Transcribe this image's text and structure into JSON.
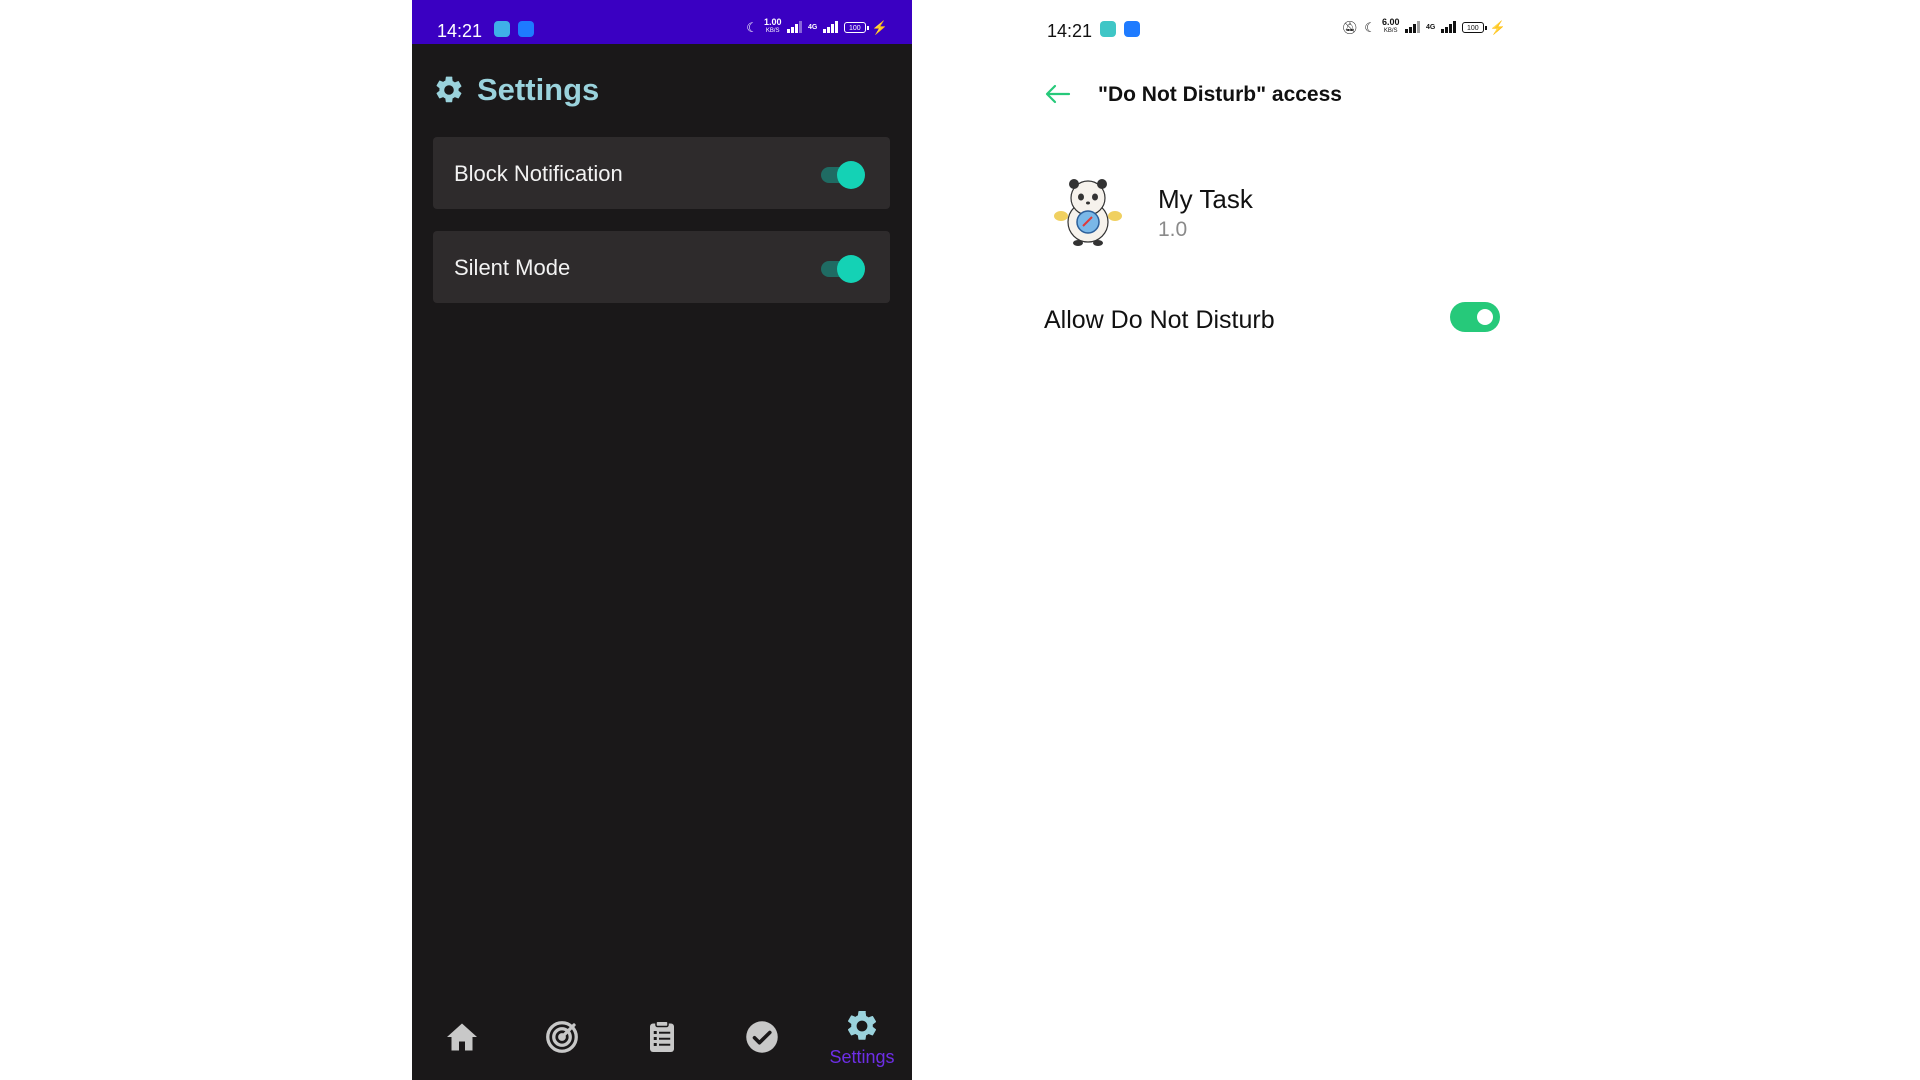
{
  "left_screen": {
    "status_bar": {
      "time": "14:21",
      "net_speed_value": "1.00",
      "net_speed_unit": "KB/S",
      "network_type": "4G",
      "battery": "100"
    },
    "title": "Settings",
    "settings": [
      {
        "label": "Block Notification",
        "enabled": true
      },
      {
        "label": "Silent Mode",
        "enabled": true
      }
    ],
    "bottom_nav": {
      "items": [
        "home-icon",
        "target-icon",
        "clipboard-list-icon",
        "check-circle-icon",
        "settings-gear-icon"
      ],
      "active_label": "Settings"
    },
    "colors": {
      "status_bar": "#3a00c2",
      "background": "#1a1819",
      "title": "#9ad2dc",
      "card": "#2e2b2c",
      "switch_thumb": "#14d2b5",
      "active_nav": "#6d2ee6"
    }
  },
  "right_screen": {
    "status_bar": {
      "time": "14:21",
      "net_speed_value": "6.00",
      "net_speed_unit": "KB/S",
      "network_type": "4G",
      "battery": "100"
    },
    "header_title": "\"Do Not Disturb\" access",
    "app": {
      "name": "My Task",
      "version": "1.0"
    },
    "allow_label": "Allow Do Not Disturb",
    "allow_enabled": true,
    "colors": {
      "accent": "#26c97a"
    }
  }
}
